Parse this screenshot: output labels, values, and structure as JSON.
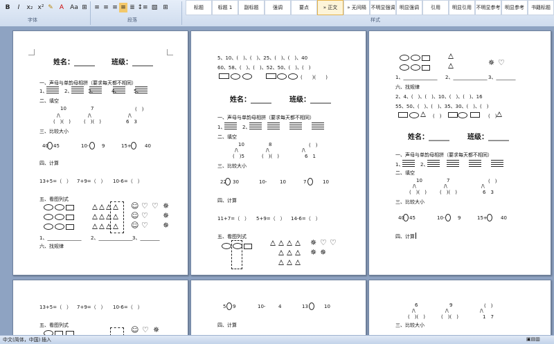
{
  "ribbon": {
    "font_buttons": [
      "x₂",
      "x²",
      "Aa",
      "A"
    ],
    "group_labels": {
      "font": "字体",
      "paragraph": "段落",
      "styles": "样式"
    },
    "styles": [
      "标题",
      "标题 1",
      "副标题",
      "强调",
      "要点",
      "» 正文",
      "» 无间隔",
      "不明显强调",
      "明显强调",
      "引用",
      "明显引用",
      "不明显参考",
      "明显参考",
      "书籍标题"
    ]
  },
  "worksheet": {
    "name_line": "姓名：______",
    "class_line": "班级：______",
    "s1": "一、声母与单韵母相拼（要求每天都不相同）",
    "s1_items": [
      "1、",
      "2、",
      "3、",
      "4、",
      "5、"
    ],
    "s2": "二、填空",
    "s2_nums": [
      "10",
      "7",
      "(　)",
      "(　)(　)",
      "(　)(　)",
      "6　3",
      "(　)5",
      "8",
      "6　1"
    ],
    "s3": "三、比较大小",
    "s3_a": [
      "40",
      "45",
      "10-",
      "9",
      "15+",
      "40"
    ],
    "s3_b": [
      "22",
      "30",
      "10-",
      "10",
      "7",
      "10"
    ],
    "s3_c": [
      "5",
      "9",
      "10-",
      "4",
      "13",
      "10"
    ],
    "s4": "四、计算",
    "s4_items": [
      "13+5=（　）",
      "7+9=（　）",
      "10-6=（　）"
    ],
    "s4_items_b": [
      "11+7=（　）",
      "5+9=（　）",
      "14-6=（　）"
    ],
    "s5": "五、看图列式",
    "s5_blanks": [
      "1、______________",
      "2、______________",
      "3、________"
    ],
    "s6": "六、找规律",
    "pattern_1": "5、10、(　)、(　)、25、(　)、(　)、40",
    "pattern_2": "60、58、(　)、(　)、52、50、(　)、(　)",
    "pattern_3": "2、4、(　)、(　)、10、(　)、(　)、16",
    "pattern_4": "55、50、(　)、(　)、35、30、(　)、(　)",
    "brackets_3": "(　　)(　　)",
    "brackets_short": "(　)",
    "cursor_label": "四、计算"
  },
  "statusbar": {
    "language": "中文(简体，中国)",
    "mode": "插入"
  },
  "colors": {
    "ribbon": "#d6e2f3",
    "workspace": "#8ea3c2",
    "page": "#ffffff"
  }
}
